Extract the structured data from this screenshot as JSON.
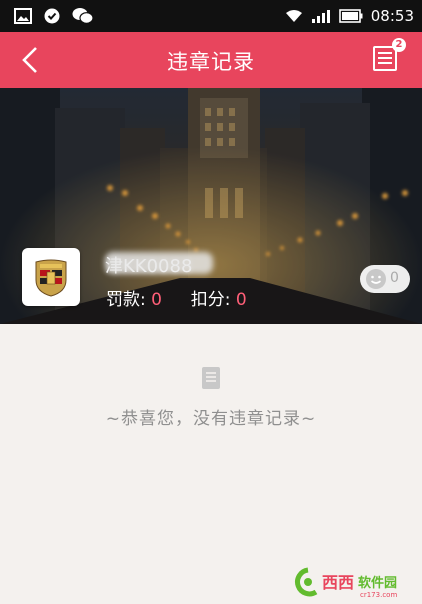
{
  "status_bar": {
    "time": "08:53",
    "icons": [
      "gallery-icon",
      "check-badge-icon",
      "wechat-icon",
      "wifi-icon",
      "signal-icon",
      "battery-icon"
    ]
  },
  "header": {
    "title": "违章记录",
    "back_icon": "chevron-left-icon",
    "list_icon": "list-icon",
    "list_badge": "2"
  },
  "car": {
    "plate": "津KK0088",
    "fine_label": "罚款:",
    "fine_value": "0",
    "points_label": "扣分:",
    "points_value": "0",
    "comment_count": "0"
  },
  "empty_state": {
    "icon": "document-icon",
    "message": "~恭喜您，没有违章记录~"
  },
  "watermark": {
    "text": "西西软件园",
    "sub": "cr173.com"
  },
  "colors": {
    "accent": "#e8455d",
    "fine_value": "#ff5f78",
    "background": "#f4f1ee"
  }
}
